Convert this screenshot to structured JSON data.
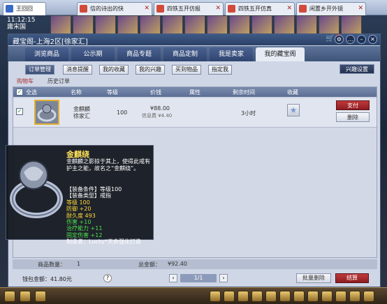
{
  "browser_tabs": [
    {
      "label": "王回回",
      "active": true
    },
    {
      "label": "信的诗出的快",
      "active": false
    },
    {
      "label": "四铁五开仿报",
      "active": false
    },
    {
      "label": "四铁五开仿真",
      "active": false
    },
    {
      "label": "闲置乡开外镜",
      "active": false
    }
  ],
  "game_clock": {
    "time": "11:12:15",
    "place": "庸宋国"
  },
  "window": {
    "title": "藏宝阁-上海2区[徐家汇]"
  },
  "cart_badge": "1",
  "nav_tabs": [
    "浏览商品",
    "公示期",
    "商品专题",
    "商品定制",
    "我是卖家",
    "我的藏宝阁"
  ],
  "sub_tabs": [
    "订单管理",
    "消息提醒",
    "我的收藏",
    "我的兴趣",
    "买到物品",
    "指定我"
  ],
  "interest_setting": "兴趣设置",
  "cart_tabs": [
    "购物车",
    "历史订单"
  ],
  "table": {
    "headers": {
      "all": "全选",
      "name": "名称",
      "level": "等级",
      "price": "价钱",
      "attr": "属性",
      "time": "剩余时间",
      "fav": "收藏"
    },
    "row": {
      "name_line1": "金麒麟",
      "name_line2": "徐家汇",
      "level": "100",
      "price": "¥88.00",
      "fee": "信息费 ¥4.40",
      "time": "3小时",
      "pay": "支付",
      "delete": "删除"
    }
  },
  "tooltip": {
    "title": "金麒绕",
    "desc": "金麒麟之影掠于其上，使得此戒有护主之能，故名之“金麒绕”。",
    "lines": [
      {
        "text": "【装备条件】等级100",
        "color": "white"
      },
      {
        "text": "【装备类型】戒指",
        "color": "white"
      },
      {
        "text": "等级 100",
        "color": "yellow"
      },
      {
        "text": "防御 +20",
        "color": "yellow"
      },
      {
        "text": "耐久度 493",
        "color": "yellow"
      },
      {
        "text": "伤害 +10",
        "color": "green"
      },
      {
        "text": "治疗能力 +11",
        "color": "green"
      },
      {
        "text": "固定伤害 +12",
        "color": "green"
      },
      {
        "text": "制造者：Lucky*天命强化打造",
        "color": "white"
      }
    ]
  },
  "summary": {
    "count_label": "商品数量：",
    "count": "1",
    "total_label": "总金额：",
    "total": "¥92.40"
  },
  "footer": {
    "balance": "钱包金额：41.80元",
    "help": "?",
    "page": "1/1",
    "batch_delete": "批量删除",
    "checkout": "结算"
  },
  "colors": {
    "accent_red": "#a82226",
    "nav_blue": "#3e5478",
    "tooltip_yellow": "#ffdc3a",
    "tooltip_green": "#4de14d"
  }
}
